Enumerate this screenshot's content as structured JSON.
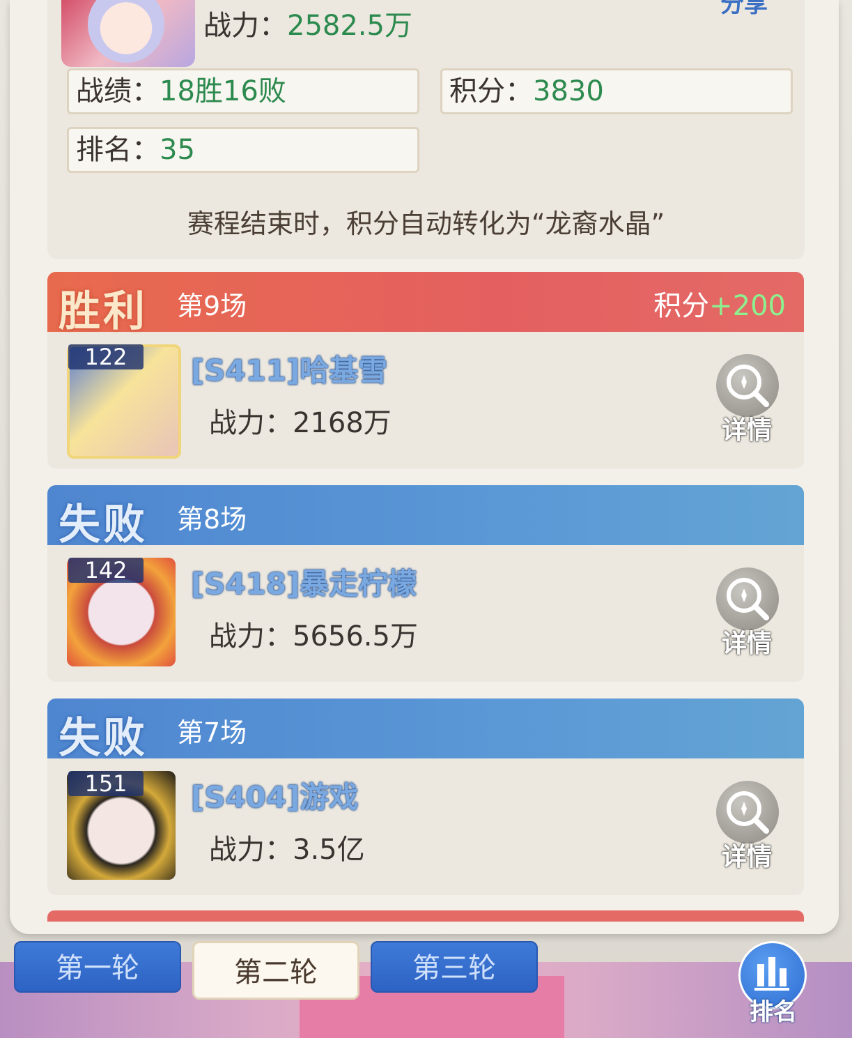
{
  "header": {
    "power_label": "战力：",
    "power_value": "2582.5万",
    "share_label": "分享"
  },
  "stats": {
    "record_label": "战绩：",
    "record_value": "18胜16败",
    "points_label": "积分：",
    "points_value": "3830",
    "rank_label": "排名：",
    "rank_value": "35"
  },
  "note": "赛程结束时，积分自动转化为“龙裔水晶”",
  "matches": [
    {
      "result": "胜利",
      "round": "第9场",
      "score_label": "积分",
      "score_value": "+200",
      "level": "122",
      "name": "[S411]哈基雪",
      "power_label": "战力：",
      "power": "2168万",
      "detail": "详情"
    },
    {
      "result": "失败",
      "round": "第8场",
      "level": "142",
      "name": "[S418]暴走柠檬",
      "power_label": "战力：",
      "power": "5656.5万",
      "detail": "详情"
    },
    {
      "result": "失败",
      "round": "第7场",
      "level": "151",
      "name": "[S404]游戏",
      "power_label": "战力：",
      "power": "3.5亿",
      "detail": "详情"
    }
  ],
  "tabs": [
    "第一轮",
    "第二轮",
    "第三轮"
  ],
  "active_tab": "第二轮",
  "ranking_button": "排名",
  "icons": {
    "detail": "magnifier-icon",
    "ranking": "bar-chart-icon"
  },
  "colors": {
    "win_header": "#e46060",
    "lose_header": "#5a98d6",
    "value_green": "#2c8a4e",
    "tab_blue": "#2d63c4"
  }
}
